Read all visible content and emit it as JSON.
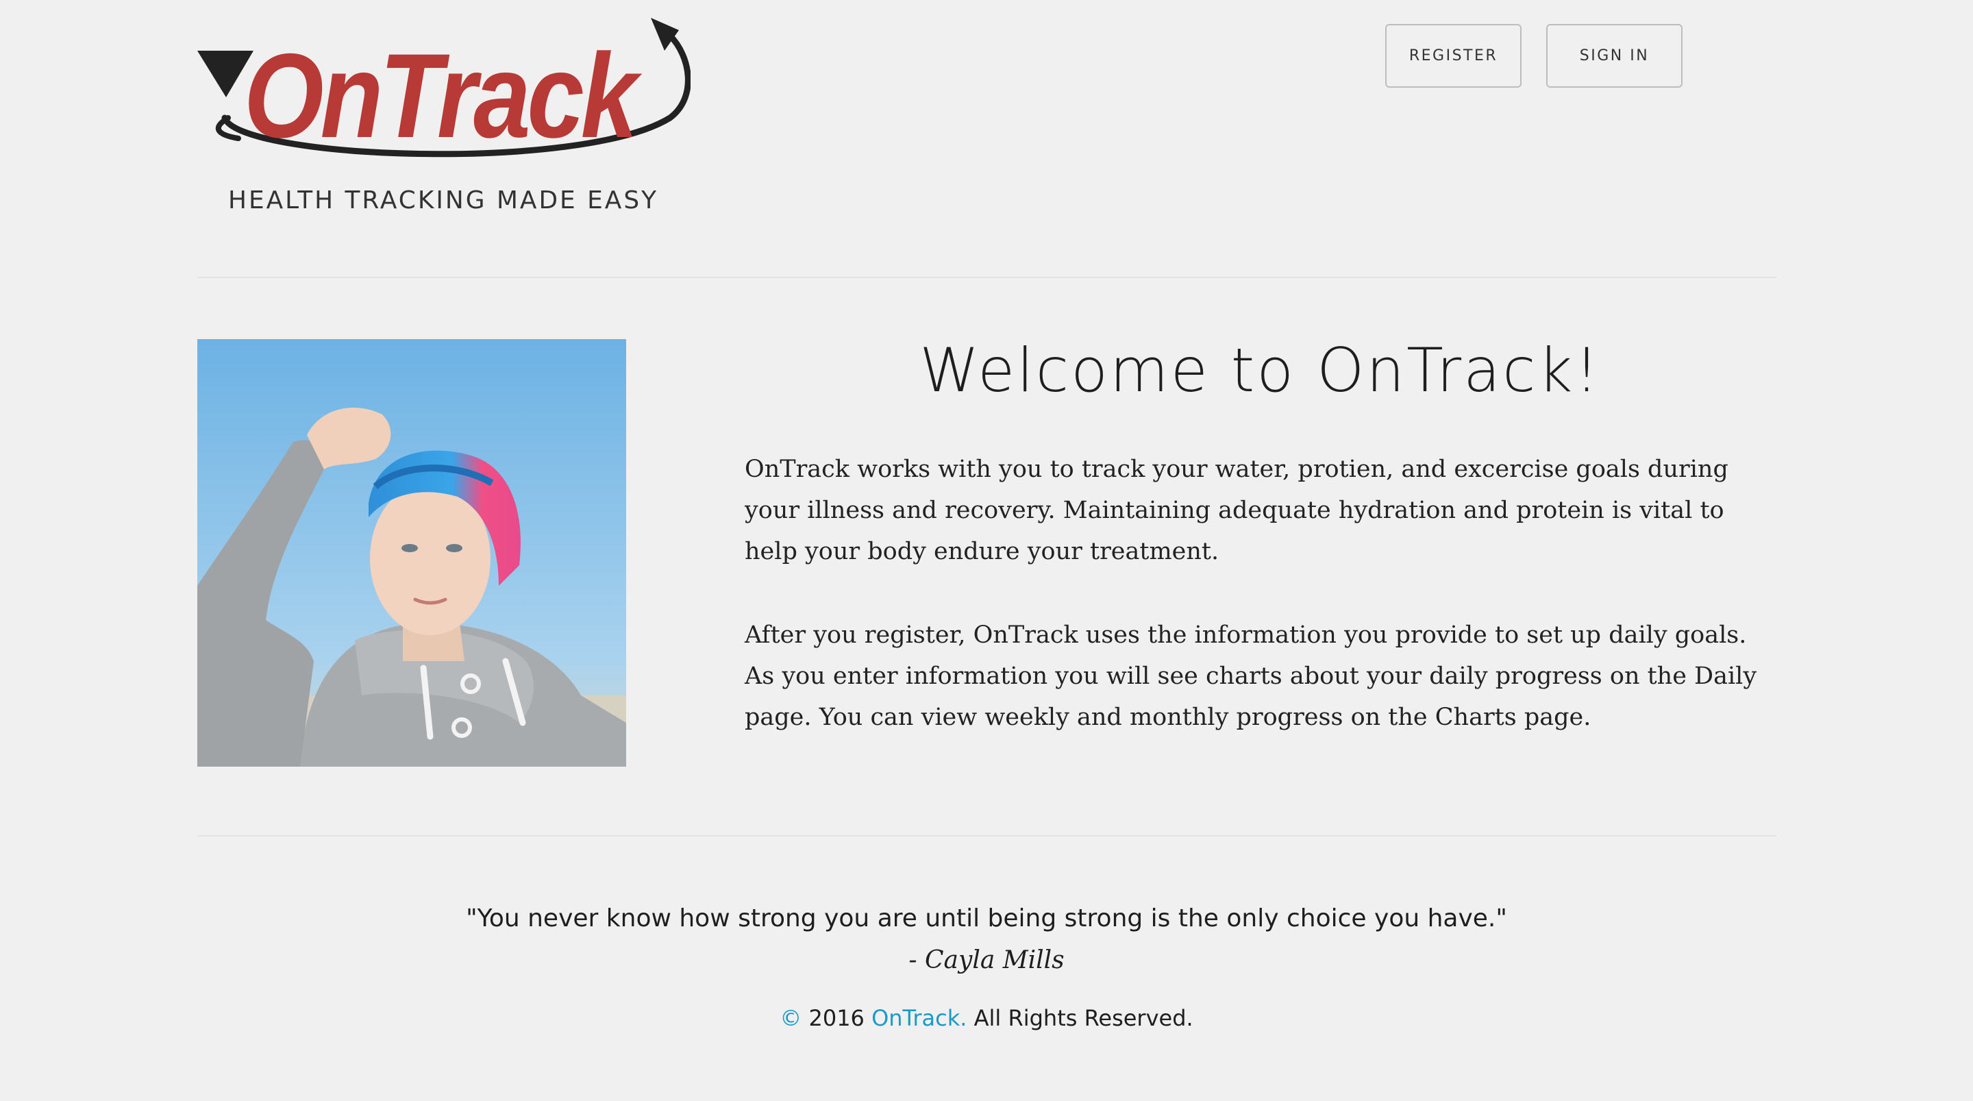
{
  "brand": {
    "name": "OnTrack",
    "tagline": "HEALTH TRACKING MADE EASY",
    "wordmark_color": "#b83a37",
    "swoosh_color": "#222222"
  },
  "header": {
    "register_label": "REGISTER",
    "signin_label": "SIGN IN"
  },
  "main": {
    "title": "Welcome to OnTrack!",
    "paragraphs": [
      "OnTrack works with you to track your water, protien, and excercise goals during your illness and recovery. Maintaining adequate hydration and protein is vital to help your body endure your treatment.",
      "After you register, OnTrack uses the information you provide to set up daily goals. As you enter information you will see charts about your daily progress on the Daily page. You can view weekly and monthly progress on the Charts page."
    ]
  },
  "quote": {
    "text": "\"You never know how strong you are until being strong is the only choice you have.\"",
    "author": "- Cayla Mills"
  },
  "footer": {
    "copyright_symbol": "©",
    "year": "2016",
    "brand_link": "OnTrack.",
    "rights": "All Rights Reserved."
  },
  "colors": {
    "background": "#f0f0f0",
    "link": "#1a9bc7",
    "divider": "#e2e2e2"
  }
}
